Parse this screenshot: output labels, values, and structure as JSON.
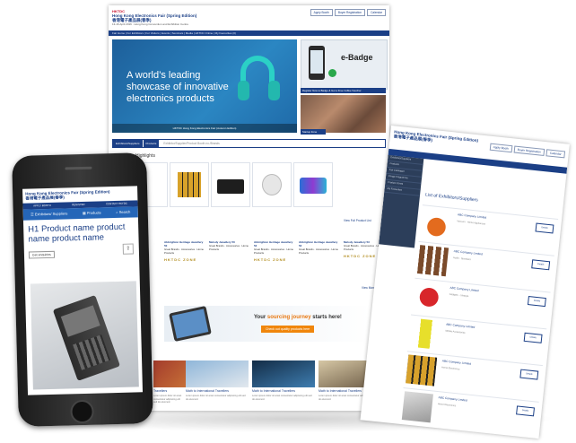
{
  "desktop": {
    "logo_red": "HKTDC",
    "title": "Hong Kong Electronics Fair (Spring Edition)",
    "title_cn": "香港電子產品展(春季)",
    "subtitle": "13-16 April 2016 · Hong Kong Convention and Exhibition Centre",
    "top_buttons": [
      "Apply Booth",
      "Buyer Registration",
      "Calendar"
    ],
    "nav": "Fair Home  |  For Exhibitors  |  For Visitors  |  Events  |  Seminars  |  Media  |  HKTDC Online  |  My Favourites (0)",
    "hero_line1": "A world’s leading",
    "hero_line2": "showcase of innovative",
    "hero_line3": "electronics products",
    "hero_caption": "HKTDC Hong Kong Electronics Fair (Autumn Edition)",
    "ebadge_label": "e-Badge",
    "ebadge_caption": "Register Now to Badge & Get a Free Coffee Voucher",
    "crowd_caption": "Startup Zone",
    "search_tabs": [
      "Exhibitors/Suppliers",
      "Products"
    ],
    "search_placeholder": "Exhibitor/Supplier/Product Booth no./Brands",
    "highlights_title": "Highlights",
    "view_all_products": "View Full Product List",
    "cards": [
      {
        "name": "Abbrighton Heritage Jewellery 50",
        "tags": "Great Brands · Accessories · Home Products"
      },
      {
        "name": "Melody Jewellery 50",
        "tags": "Great Brands · Accessories · Home Products"
      },
      {
        "name": "Abbrighton Heritage Jewellery 52",
        "tags": "Great Brands · Accessories · Home Products"
      },
      {
        "name": "Abbrighton Heritage Jewellery 52",
        "tags": "Great Brands · Accessories · Home Products"
      },
      {
        "name": "Melody Jewellery 53",
        "tags": "Great Brands · Accessories · Home Products"
      }
    ],
    "badge_text": "HKTDC ZONE",
    "view_more": "View More",
    "banner_text_a": "Your ",
    "banner_text_b": "sourcing journey",
    "banner_text_c": " starts here!",
    "banner_button": "Check out quality products here",
    "articles": [
      {
        "caption": "Travellers",
        "text": "Lorem ipsum dolor sit amet consectetur adipiscing elit sed do eiusmod."
      },
      {
        "caption": "Math to International Travellers",
        "text": "Lorem ipsum dolor sit amet consectetur adipiscing elit sed do eiusmod."
      },
      {
        "caption": "Math to International Travellers",
        "text": "Lorem ipsum dolor sit amet consectetur adipiscing elit sed do eiusmod."
      },
      {
        "caption": "Math to International Travellers",
        "text": "Lorem ipsum dolor sit amet consectetur adipiscing elit sed do eiusmod."
      }
    ]
  },
  "right": {
    "title": "Hong Kong Electronics Fair (Spring Edition)",
    "title_cn": "香港電子產品展(春季)",
    "buttons": [
      "Apply Booth",
      "Buyer Registration",
      "Calendar"
    ],
    "sidebar": [
      "Exhibitors/Suppliers",
      "Products",
      "Fair Catalogue",
      "Fringe Programme",
      "Product Zones",
      "My Favourites"
    ],
    "list_title": "List of Exhibitors/Suppliers",
    "rows": [
      {
        "name": "ABC Company Limited",
        "tags": "Vacuum · Home Appliances",
        "btn": "Details"
      },
      {
        "name": "ABC Company Limited",
        "tags": "Audio · Speakers",
        "btn": "Details"
      },
      {
        "name": "ABC Company Limited",
        "tags": "Gadgets · Lifestyle",
        "btn": "Details"
      },
      {
        "name": "ABC Company Limited",
        "tags": "Mobile Accessories",
        "btn": "Details"
      },
      {
        "name": "ABC Company Limited",
        "tags": "Home Electronics",
        "btn": "Details"
      },
      {
        "name": "ABC Company Limited",
        "tags": "Home Electronics",
        "btn": "Details"
      }
    ]
  },
  "phone": {
    "title": "Hong Kong Electronics Fair (Spring Edition)",
    "title_cn": "香港電子產品展(春季)",
    "nav": [
      "APPLY BOOTH",
      "REGISTER",
      "CONTACT HKTDC"
    ],
    "tabs": [
      "Exhibitors/ Suppliers",
      "Products",
      "Search"
    ],
    "h1": "H1 Product name product name product name",
    "enquiry_button": "Get enquiries"
  }
}
